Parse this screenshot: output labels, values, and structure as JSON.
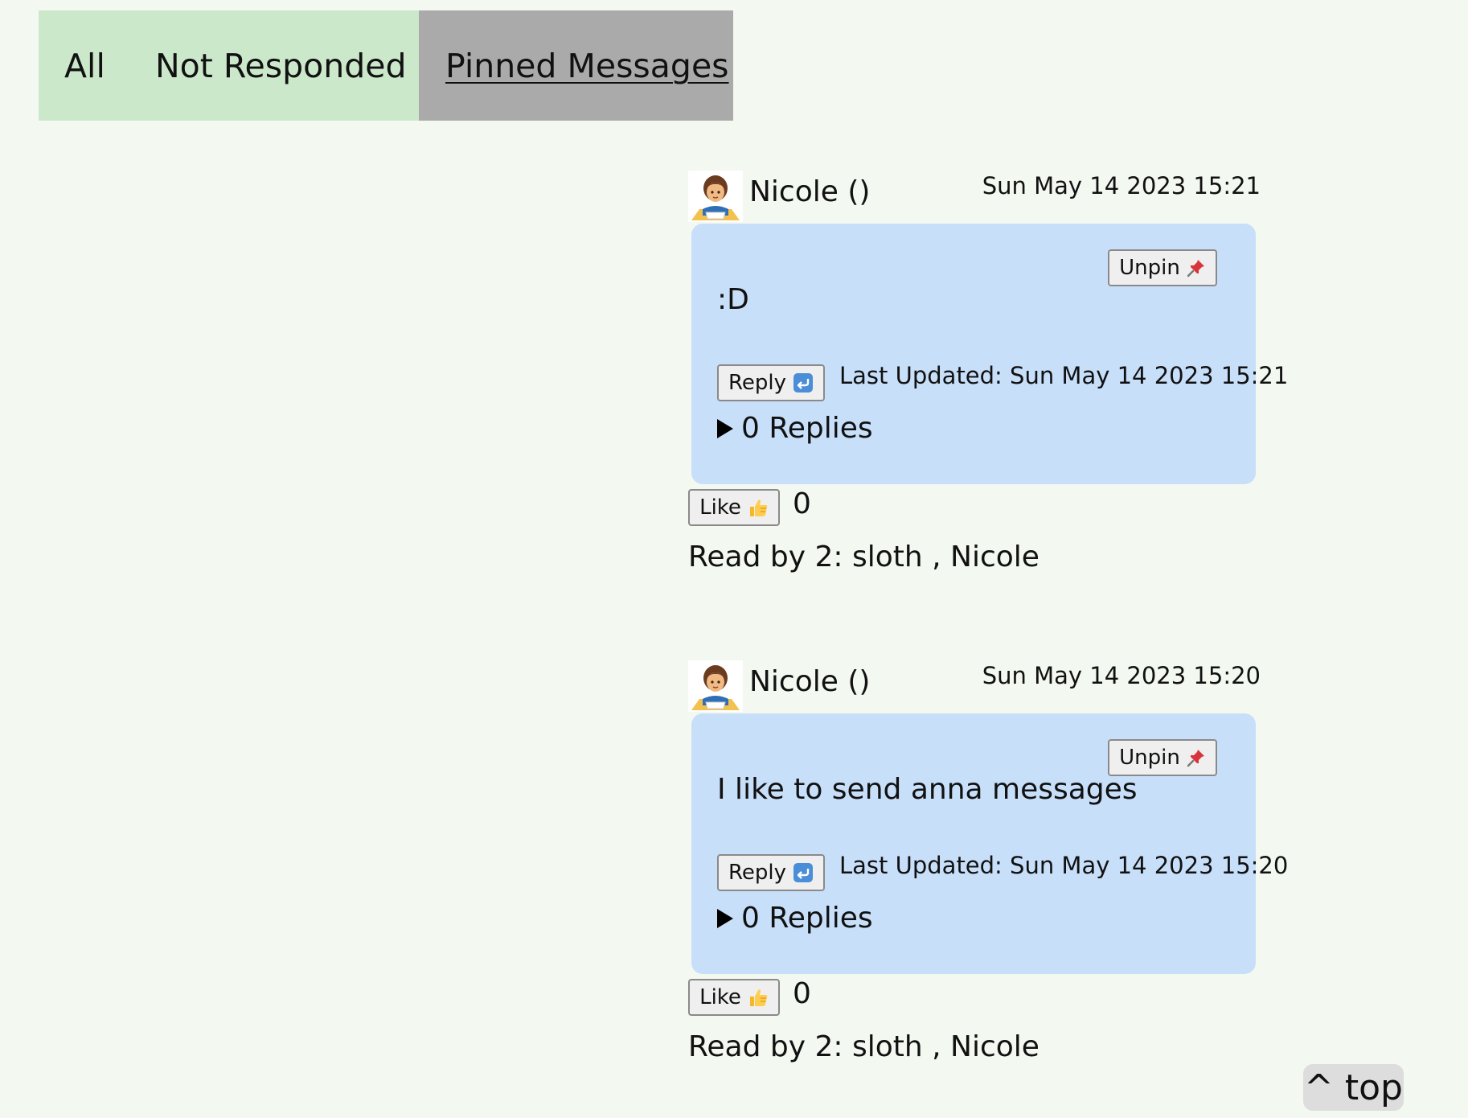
{
  "tabs": [
    {
      "label": "All"
    },
    {
      "label": "Not Responded"
    },
    {
      "label": "Pinned Messages",
      "active": true
    }
  ],
  "messages": [
    {
      "author": "Nicole ()",
      "timestamp": "Sun May 14 2023 15:21",
      "text": ":D",
      "unpin_label": "Unpin",
      "reply_label": "Reply",
      "last_updated": "Last Updated: Sun May 14 2023 15:21",
      "replies": "0 Replies",
      "like_label": "Like",
      "like_count": "0",
      "read_by": "Read by 2: sloth , Nicole"
    },
    {
      "author": "Nicole ()",
      "timestamp": "Sun May 14 2023 15:20",
      "text": "I like to send anna messages",
      "unpin_label": "Unpin",
      "reply_label": "Reply",
      "last_updated": "Last Updated: Sun May 14 2023 15:20",
      "replies": "0 Replies",
      "like_label": "Like",
      "like_count": "0",
      "read_by": "Read by 2: sloth , Nicole"
    }
  ],
  "scroll_top_label": "^ top",
  "icons": {
    "avatar": "student-avatar-icon",
    "pin": "pushpin-icon",
    "reply": "return-arrow-icon",
    "like": "thumbs-up-icon",
    "expand": "triangle-right-icon"
  },
  "colors": {
    "page_bg": "#f3f8f1",
    "tab_inactive_bg": "#cce8cb",
    "tab_active_bg": "#aaaaaa",
    "bubble_bg": "#c8dffa"
  }
}
